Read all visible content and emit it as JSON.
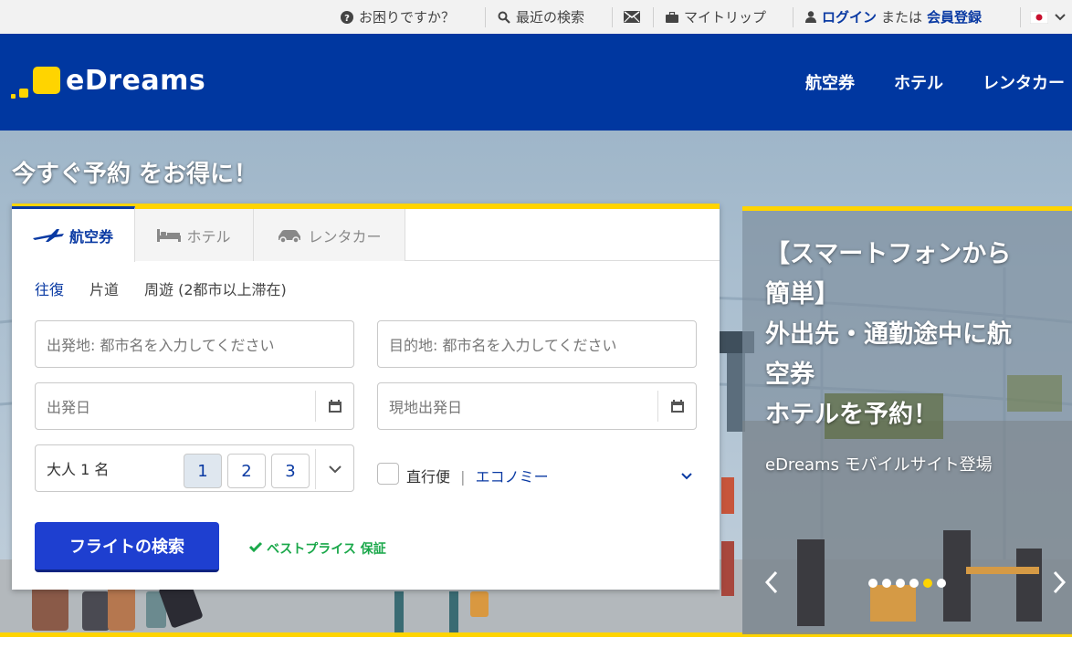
{
  "utility_bar": {
    "help": "お困りですか？",
    "recent_search": "最近の検索",
    "my_trip": "マイトリップ",
    "login": "ログイン",
    "or": "または",
    "register": "会員登録"
  },
  "header": {
    "brand": "eDreams",
    "nav": [
      "航空券",
      "ホテル",
      "レンタカー"
    ]
  },
  "hero": {
    "title": "今すぐ予約 をお得に！"
  },
  "search": {
    "tabs": [
      "航空券",
      "ホテル",
      "レンタカー"
    ],
    "trip_types": [
      "往復",
      "片道",
      "周遊 (2都市以上滞在)"
    ],
    "origin_placeholder": "出発地: 都市名を入力してください",
    "destination_placeholder": "目的地: 都市名を入力してください",
    "depart_placeholder": "出発日",
    "return_placeholder": "現地出発日",
    "adults_label": "大人 1 名",
    "pax_options": [
      "1",
      "2",
      "3"
    ],
    "direct_label": "直行便",
    "cabin_class": "エコノミー",
    "search_button": "フライトの検索",
    "best_price": "ベストプライス 保証"
  },
  "promo": {
    "headline_lines": [
      "【スマートフォンから",
      "簡単】",
      "外出先・通勤途中に航",
      "空券",
      "ホテルを予約！"
    ],
    "subtext": "eDreams モバイルサイト登場",
    "dot_count": 6,
    "active_dot": 5
  },
  "colors": {
    "brand_blue": "#0037a0",
    "accent_yellow": "#ffd400",
    "link_blue": "#0a3aa3",
    "button_blue": "#1e3fd0",
    "success_green": "#1aa84a"
  }
}
